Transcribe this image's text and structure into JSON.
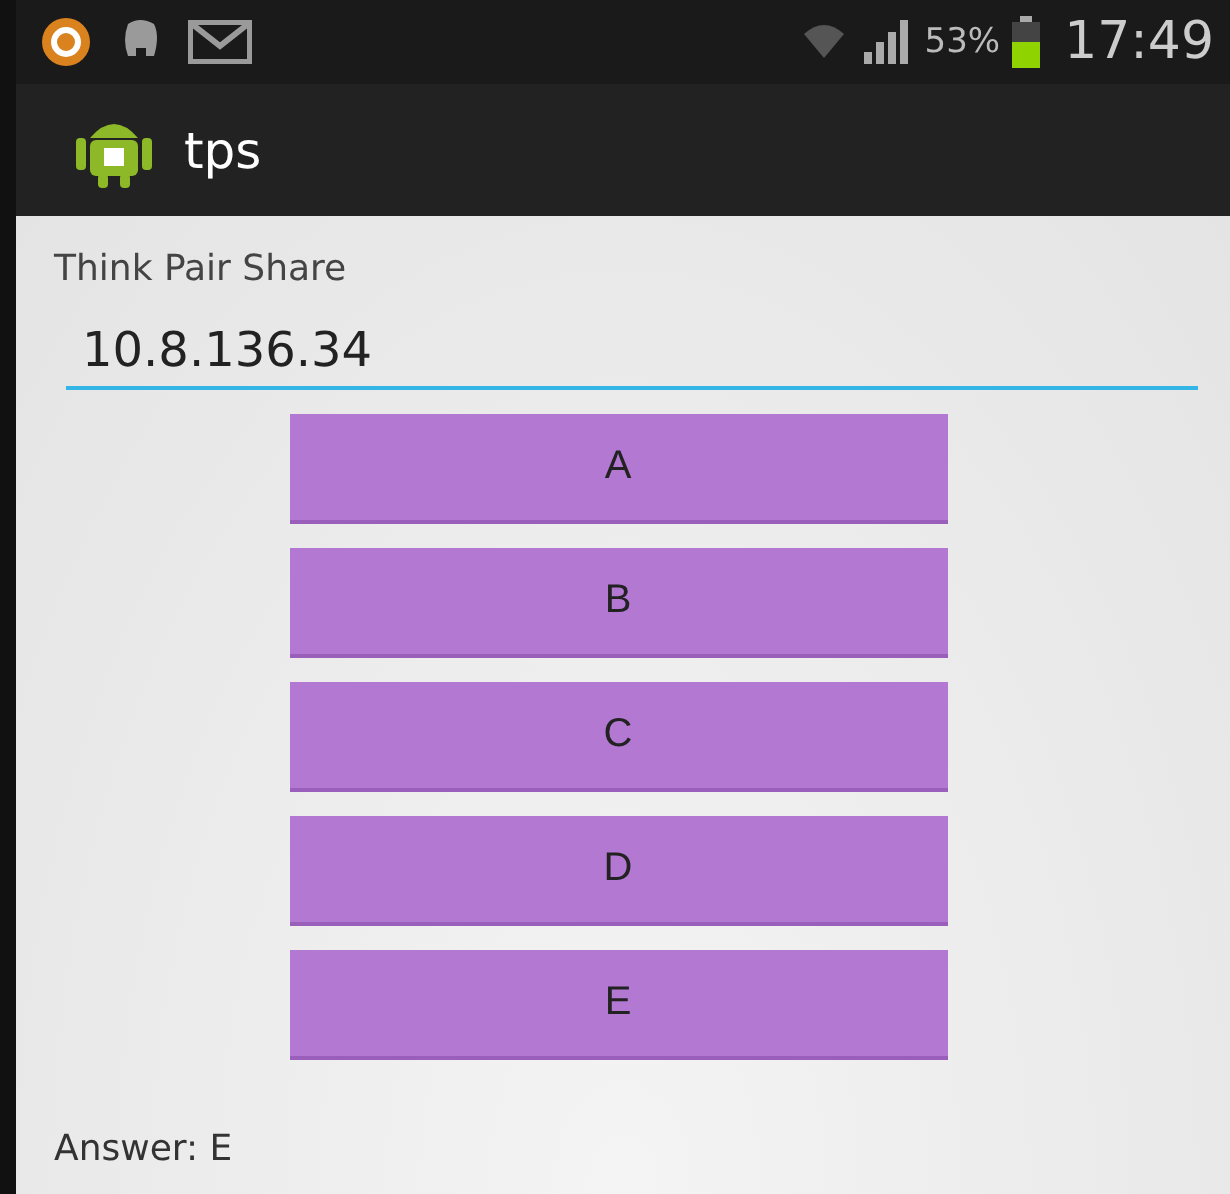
{
  "status_bar": {
    "battery_text": "53%",
    "time": "17:49"
  },
  "action_bar": {
    "title": "tps"
  },
  "label": "Think Pair Share",
  "address_field": {
    "value": "10.8.136.34"
  },
  "buttons": [
    "A",
    "B",
    "C",
    "D",
    "E"
  ],
  "answer": "Answer: E"
}
